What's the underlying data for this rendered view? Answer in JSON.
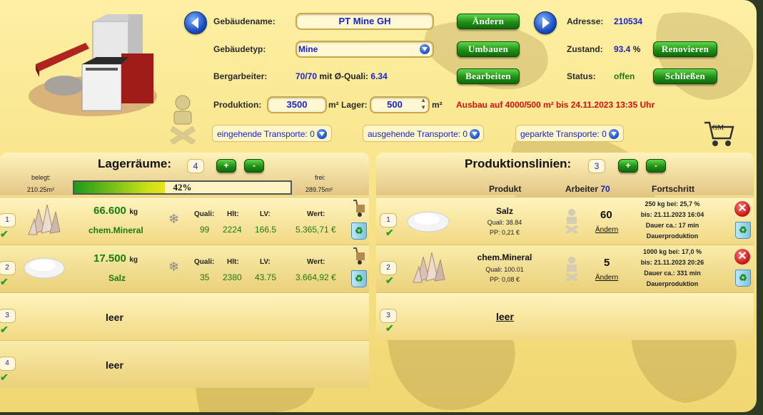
{
  "building": {
    "name_label": "Gebäudename:",
    "name_value": "PT Mine GH",
    "change_button": "Ändern",
    "address_label": "Adresse:",
    "address_value": "210534",
    "type_label": "Gebäudetyp:",
    "type_value": "Mine",
    "convert_button": "Umbauen",
    "condition_label": "Zustand:",
    "condition_value": "93.4",
    "condition_unit": "%",
    "renovate_button": "Renovieren",
    "workers_label": "Bergarbeiter:",
    "workers_value": "70/70",
    "workers_mid": "mit Ø-Quali:",
    "workers_quality": "6.34",
    "edit_button": "Bearbeiten",
    "status_label": "Status:",
    "status_value": "offen",
    "close_button": "Schließen",
    "production_label": "Produktion:",
    "production_value": "3500",
    "storage_unit_label": "m² Lager:",
    "storage_value": "500",
    "storage_unit": "m²",
    "expansion_text": "Ausbau auf 4000/500 m² bis 24.11.2023 13:35 Uhr",
    "transport_in": "eingehende Transporte: 0",
    "transport_out": "ausgehende Transporte: 0",
    "transport_parked": "geparkte Transporte: 0",
    "cart_label": "GM"
  },
  "storage": {
    "title": "Lagerräume:",
    "count": "4",
    "plus": "+",
    "minus": "-",
    "used_label": "belegt:",
    "used_value": "210.25m²",
    "free_label": "frei:",
    "free_value": "289.75m²",
    "fill_percent": 42,
    "fill_text": "42%",
    "headers": {
      "quality": "Quali:",
      "hlt": "Hlt:",
      "lv": "LV:",
      "value": "Wert:"
    },
    "rows": [
      {
        "num": "1",
        "amount": "66.600",
        "unit": "kg",
        "product": "chem.Mineral",
        "quality": "99",
        "hlt": "2224",
        "lv": "166.5",
        "value": "5.365,71 €",
        "icon": "mineral-icon"
      },
      {
        "num": "2",
        "amount": "17.500",
        "unit": "kg",
        "product": "Salz",
        "quality": "35",
        "hlt": "2380",
        "lv": "43.75",
        "value": "3.664,92 €",
        "icon": "salt-icon"
      },
      {
        "num": "3",
        "empty": "leer"
      },
      {
        "num": "4",
        "empty": "leer"
      }
    ]
  },
  "production": {
    "title": "Produktionslinien:",
    "count": "3",
    "plus": "+",
    "minus": "-",
    "col_product": "Produkt",
    "col_workers": "Arbeiter",
    "col_workers_count": "70",
    "col_progress": "Fortschritt",
    "lines": [
      {
        "num": "1",
        "product": "Salz",
        "quality": "Quali: 38.84",
        "pp": "PP: 0,21 €",
        "workers": "60",
        "change": "Ändern",
        "progress": [
          "250 kg bei: 25,7 %",
          "bis: 21.11.2023 16:04",
          "Dauer ca.: 17 min",
          "Dauerproduktion"
        ]
      },
      {
        "num": "2",
        "product": "chem.Mineral",
        "quality": "Quali: 100.01",
        "pp": "PP: 0,08 €",
        "workers": "5",
        "change": "Ändern",
        "progress": [
          "1000 kg bei: 17,0 %",
          "bis: 21.11.2023 20:26",
          "Dauer ca.: 331 min",
          "Dauerproduktion"
        ]
      },
      {
        "num": "3",
        "empty": "leer"
      }
    ]
  },
  "colors": {
    "accent_green": "#1f8f16",
    "text_blue": "#1a24c8",
    "warning_red": "#d21010"
  }
}
